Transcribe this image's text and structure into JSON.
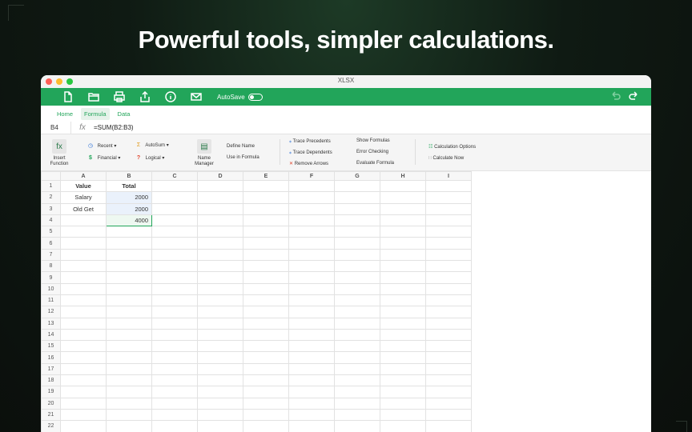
{
  "headline": "Powerful tools, simpler calculations.",
  "window": {
    "title": "XLSX"
  },
  "toolbar": {
    "icons": [
      "new-file-icon",
      "open-folder-icon",
      "print-icon",
      "share-icon",
      "info-icon",
      "mail-icon"
    ],
    "autosave_label": "AutoSave",
    "autosave_on": false
  },
  "tabs": [
    {
      "label": "Home",
      "active": false
    },
    {
      "label": "Formula",
      "active": true
    },
    {
      "label": "Data",
      "active": false
    }
  ],
  "formula_bar": {
    "cell_ref": "B4",
    "fx": "fx",
    "formula": "=SUM(B2:B3)"
  },
  "ribbon": {
    "insert_function": "Insert Function",
    "recent": "Recent",
    "autosum": "AutoSum",
    "financial": "Financial",
    "logical": "Logical",
    "name_manager": "Name Manager",
    "define_name": "Define Name",
    "use_in_formula": "Use in Formula",
    "trace_precedents": "Trace Precedents",
    "trace_dependents": "Trace Dependents",
    "remove_arrows": "Remove Arrows",
    "show_formulas": "Show Formulas",
    "error_checking": "Error Checking",
    "evaluate_formula": "Evaluate Formula",
    "calculation_options": "Calculation Options",
    "calculate_now": "Calculate Now"
  },
  "sheet": {
    "columns": [
      "A",
      "B",
      "C",
      "D",
      "E",
      "F",
      "G",
      "H",
      "I"
    ],
    "rows": [
      "1",
      "2",
      "3",
      "4",
      "5",
      "6",
      "7",
      "8",
      "9",
      "10",
      "11",
      "12",
      "13",
      "14",
      "15",
      "16",
      "17",
      "18",
      "19",
      "20",
      "21",
      "22"
    ],
    "cells": {
      "A1": "Value",
      "B1": "Total",
      "A2": "Salary",
      "B2": "2000",
      "A3": "Old Get",
      "B3": "2000",
      "B4": "4000"
    }
  },
  "colors": {
    "accent": "#22a55a"
  }
}
